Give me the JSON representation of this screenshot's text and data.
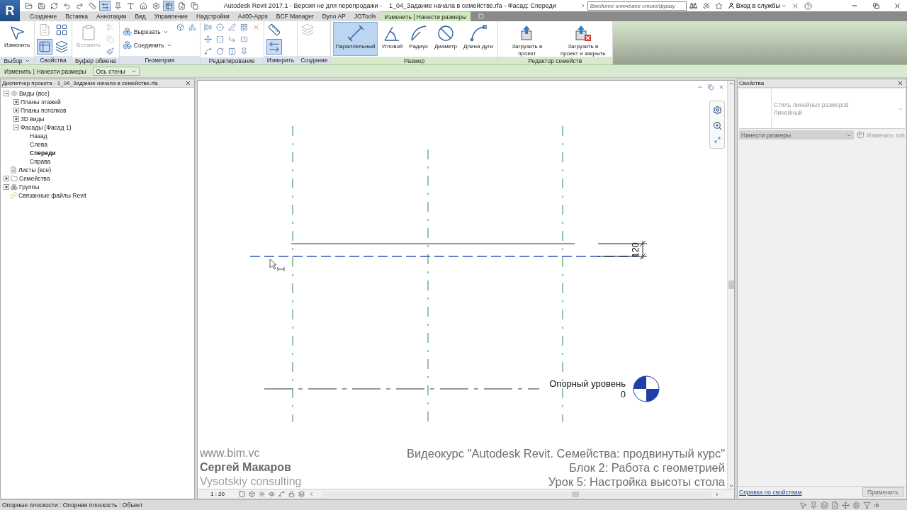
{
  "app_button": {
    "label": "R"
  },
  "window": {
    "title": "Autodesk Revit 2017.1 - Версия не для перепродажи -    1_04_Задание начала в семействе.rfa - Фасад: Спереди"
  },
  "search": {
    "placeholder": "Введите ключевое слово/фразу"
  },
  "sign_in": {
    "label": "Вход в службы"
  },
  "tabs": [
    {
      "label": "Создание",
      "selected": false
    },
    {
      "label": "Вставка",
      "selected": false
    },
    {
      "label": "Аннотации",
      "selected": false
    },
    {
      "label": "Вид",
      "selected": false
    },
    {
      "label": "Управление",
      "selected": false
    },
    {
      "label": "Надстройки",
      "selected": false
    },
    {
      "label": "A400-Apps",
      "selected": false
    },
    {
      "label": "BCF Manager",
      "selected": false
    },
    {
      "label": "Dyno AP",
      "selected": false
    },
    {
      "label": "JOTools",
      "selected": false
    },
    {
      "label": "Изменить | Нанести размеры",
      "selected": true
    }
  ],
  "ribbon": [
    {
      "label": "Выбор",
      "menu": true,
      "items": [
        {
          "kind": "large",
          "label": "Изменить",
          "selected": false,
          "disabled": false
        }
      ]
    },
    {
      "label": "Свойства",
      "menu": false,
      "items": [
        {
          "kind": "icon",
          "selected": false,
          "disabled": true
        },
        {
          "kind": "icon",
          "selected": true,
          "disabled": false
        },
        {
          "kind": "icon",
          "selected": false,
          "disabled": false
        },
        {
          "kind": "icon",
          "selected": false,
          "disabled": false
        }
      ]
    },
    {
      "label": "Буфер обмена",
      "menu": false,
      "items": [
        {
          "kind": "large",
          "label": "Вставить",
          "selected": false,
          "disabled": true
        },
        {
          "kind": "icon",
          "selected": false,
          "disabled": true
        },
        {
          "kind": "icon",
          "selected": false,
          "disabled": true
        },
        {
          "kind": "icon",
          "selected": false,
          "disabled": false
        }
      ]
    },
    {
      "label": "Геометрия",
      "menu": false,
      "items": [
        {
          "kind": "small",
          "label": "Вырезать",
          "selected": false,
          "disabled": false
        },
        {
          "kind": "small",
          "label": "Соединить",
          "selected": false,
          "disabled": false
        },
        {
          "kind": "icon",
          "selected": false,
          "disabled": false
        },
        {
          "kind": "icon",
          "selected": false,
          "disabled": false
        }
      ]
    },
    {
      "label": "Редактирование",
      "menu": false,
      "items": [
        {
          "kind": "icon",
          "selected": false,
          "disabled": false
        },
        {
          "kind": "icon",
          "selected": false,
          "disabled": false
        },
        {
          "kind": "icon",
          "selected": false,
          "disabled": false
        },
        {
          "kind": "icon",
          "selected": false,
          "disabled": false
        },
        {
          "kind": "icon",
          "selected": false,
          "disabled": false
        },
        {
          "kind": "icon",
          "selected": false,
          "disabled": false
        },
        {
          "kind": "icon",
          "selected": false,
          "disabled": false
        },
        {
          "kind": "icon",
          "selected": false,
          "disabled": false
        },
        {
          "kind": "icon",
          "selected": false,
          "disabled": false
        },
        {
          "kind": "icon",
          "selected": false,
          "disabled": false
        },
        {
          "kind": "icon",
          "selected": false,
          "disabled": false
        },
        {
          "kind": "icon",
          "selected": false,
          "disabled": false
        },
        {
          "kind": "icon",
          "selected": false,
          "disabled": false
        }
      ]
    },
    {
      "label": "Измерить",
      "menu": false,
      "items": [
        {
          "kind": "icon",
          "selected": false,
          "disabled": false
        },
        {
          "kind": "icon",
          "selected": true,
          "disabled": false
        }
      ]
    },
    {
      "label": "Создание",
      "menu": false,
      "items": [
        {
          "kind": "icon",
          "selected": false,
          "disabled": true
        }
      ]
    },
    {
      "label": "Размер",
      "menu": false,
      "items": [
        {
          "kind": "large",
          "label": "Параллельный",
          "selected": true,
          "disabled": false
        },
        {
          "kind": "large",
          "label": "Угловой",
          "selected": false,
          "disabled": false
        },
        {
          "kind": "large",
          "label": "Радиус",
          "selected": false,
          "disabled": false
        },
        {
          "kind": "large",
          "label": "Диаметр",
          "selected": false,
          "disabled": false
        },
        {
          "kind": "large",
          "label": "Длина дуги",
          "selected": false,
          "disabled": false
        }
      ]
    },
    {
      "label": "Редактор семейств",
      "menu": false,
      "items": [
        {
          "kind": "large",
          "label": "Загрузить в проект",
          "selected": false,
          "disabled": false
        },
        {
          "kind": "large",
          "label": "Загрузить в проект и закрыть",
          "selected": false,
          "disabled": false
        }
      ]
    }
  ],
  "options_bar": {
    "context": "Изменить | Нанести размеры",
    "placement": "Ось стены"
  },
  "project_browser": {
    "title": "Диспетчер проекта - 1_04_Задание начала в семействе.rfa",
    "tree": [
      {
        "label": "Виды (все)",
        "kind": "group",
        "expanded": true,
        "selected": false,
        "children": [
          {
            "label": "Планы этажей",
            "kind": "group",
            "expanded": false,
            "selected": false
          },
          {
            "label": "Планы потолков",
            "kind": "group",
            "expanded": false,
            "selected": false
          },
          {
            "label": "3D виды",
            "kind": "group",
            "expanded": false,
            "selected": false
          },
          {
            "label": "Фасады (Фасад 1)",
            "kind": "group",
            "expanded": true,
            "selected": false,
            "children": [
              {
                "label": "Назад",
                "kind": "leaf",
                "selected": false
              },
              {
                "label": "Слева",
                "kind": "leaf",
                "selected": false
              },
              {
                "label": "Спереди",
                "kind": "leaf",
                "selected": true
              },
              {
                "label": "Справа",
                "kind": "leaf",
                "selected": false
              }
            ]
          }
        ]
      },
      {
        "label": "Листы (все)",
        "kind": "leaf",
        "selected": false
      },
      {
        "label": "Семейства",
        "kind": "group",
        "expanded": false,
        "selected": false
      },
      {
        "label": "Группы",
        "kind": "group",
        "expanded": false,
        "selected": false
      },
      {
        "label": "Связанные файлы Revit",
        "kind": "leaf",
        "selected": false
      }
    ]
  },
  "view": {
    "dimension": "120",
    "level": {
      "name": "Опорный уровень",
      "elevation": "0"
    },
    "scale": "1 : 20",
    "captions_left": [
      {
        "text": "www.bim.vc",
        "kind": "site"
      },
      {
        "text": "Сергей Макаров",
        "kind": "author"
      },
      {
        "text": "Vysotskiy consulting",
        "kind": "company"
      }
    ],
    "captions_right": [
      "Видеокурс \"Autodesk Revit. Семейства: продвинутый курс\"",
      "Блок 2: Работа с геометрией",
      "Урок 5: Настройка высоты стола"
    ]
  },
  "properties": {
    "title": "Свойства",
    "type_family": "Стиль линейных размеров",
    "type_name": "Линейный",
    "filter": {
      "value": "Нанести размеры",
      "disabled": true
    },
    "edit_type": {
      "label": "Изменить тип",
      "disabled": true
    },
    "help_link": "Справка по свойствам",
    "apply": {
      "label": "Применить",
      "disabled": true
    }
  },
  "status_bar": {
    "text": "Опорные плоскости : Опорная плоскость : Объект",
    "filter_count": ":0"
  }
}
